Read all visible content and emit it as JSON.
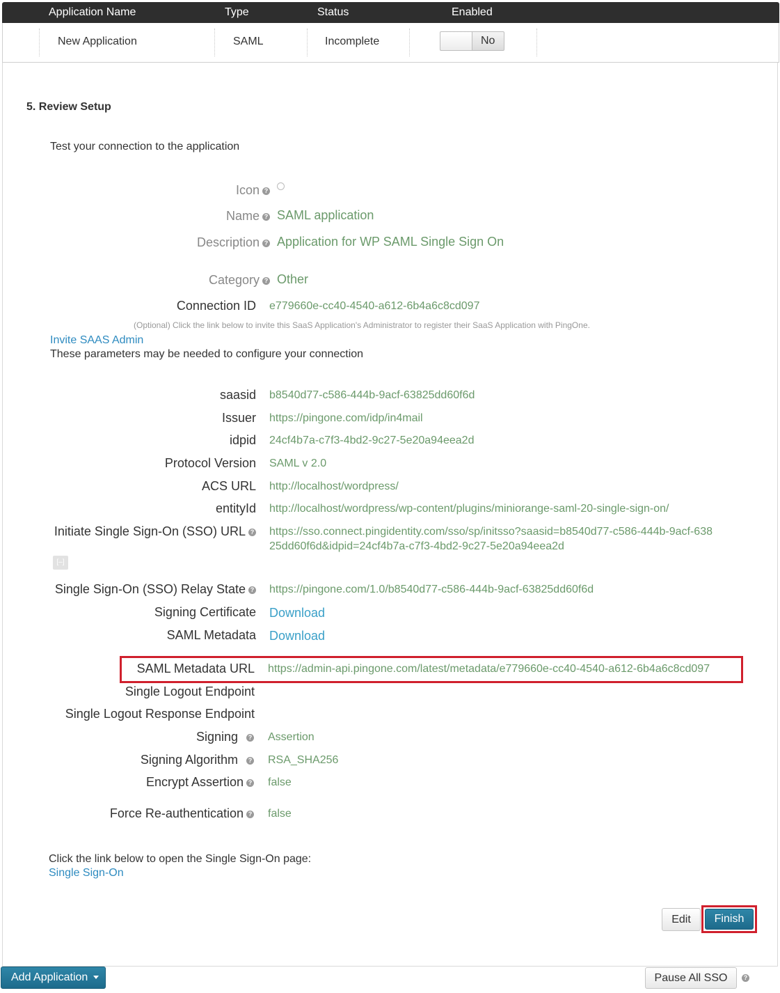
{
  "table": {
    "headers": [
      "Application Name",
      "Type",
      "Status",
      "Enabled"
    ],
    "row": {
      "name": "New Application",
      "type": "SAML",
      "status": "Incomplete",
      "enabled_label": "No"
    }
  },
  "step": {
    "title": "5. Review Setup",
    "intro": "Test your connection to the application"
  },
  "app": {
    "icon_label": "Icon",
    "name_label": "Name",
    "name_value": "SAML application",
    "description_label": "Description",
    "description_value": "Application for WP SAML Single Sign On",
    "category_label": "Category",
    "category_value": "Other",
    "connection_id_label": "Connection ID",
    "connection_id_value": "e779660e-cc40-4540-a612-6b4a6c8cd097"
  },
  "invite": {
    "note": "(Optional) Click the link below to invite this SaaS Application's Administrator to register their SaaS Application with PingOne.",
    "link": "Invite SAAS Admin",
    "params_intro": "These parameters may be needed to configure your connection"
  },
  "params": {
    "saasid_label": "saasid",
    "saasid_value": "b8540d77-c586-444b-9acf-63825dd60f6d",
    "issuer_label": "Issuer",
    "issuer_value": "https://pingone.com/idp/in4mail",
    "idpid_label": "idpid",
    "idpid_value": "24cf4b7a-c7f3-4bd2-9c27-5e20a94eea2d",
    "protocol_label": "Protocol Version",
    "protocol_value": "SAML v 2.0",
    "acs_label": "ACS URL",
    "acs_value": "http://localhost/wordpress/",
    "entity_label": "entityId",
    "entity_value": "http://localhost/wordpress/wp-content/plugins/miniorange-saml-20-single-sign-on/",
    "sso_url_label": "Initiate Single Sign-On (SSO) URL",
    "sso_url_line1": "https://sso.connect.pingidentity.com/sso/sp/initsso?saasid=b8540d77-c586-444b-9acf-638",
    "sso_url_line2": "25dd60f6d&idpid=24cf4b7a-c7f3-4bd2-9c27-5e20a94eea2d",
    "collapse_glyph": "[–]",
    "relay_label": "Single Sign-On (SSO) Relay State",
    "relay_value": "https://pingone.com/1.0/b8540d77-c586-444b-9acf-63825dd60f6d",
    "cert_label": "Signing Certificate",
    "cert_link": "Download",
    "metadata_label": "SAML Metadata",
    "metadata_link": "Download",
    "metadata_url_label": "SAML Metadata URL",
    "metadata_url_value": "https://admin-api.pingone.com/latest/metadata/e779660e-cc40-4540-a612-6b4a6c8cd097",
    "slo_label": "Single Logout Endpoint",
    "slo_resp_label": "Single Logout Response Endpoint",
    "signing_label": "Signing",
    "signing_value": "Assertion",
    "alg_label": "Signing Algorithm",
    "alg_value": "RSA_SHA256",
    "encrypt_label": "Encrypt Assertion",
    "encrypt_value": "false",
    "force_label": "Force Re-authentication",
    "force_value": "false"
  },
  "sso_page": {
    "intro": "Click the link below to open the Single Sign-On page:",
    "link": "Single Sign-On"
  },
  "buttons": {
    "edit": "Edit",
    "finish": "Finish",
    "add_application": "Add Application",
    "pause_all": "Pause All SSO"
  },
  "help_glyph": "?",
  "colors": {
    "header_bg": "#2e2e2e",
    "value_green": "#6b9a6b",
    "link_blue": "#2e8bc0",
    "highlight_red": "#d0202d",
    "primary_btn": "#1d6b8c"
  }
}
